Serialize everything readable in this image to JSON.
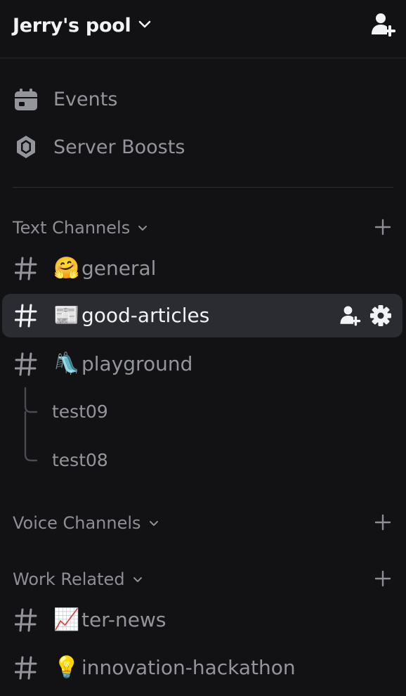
{
  "server": {
    "name": "Jerry's pool"
  },
  "menu": [
    {
      "label": "Events",
      "icon": "calendar-icon"
    },
    {
      "label": "Server Boosts",
      "icon": "boost-gem-icon"
    }
  ],
  "categories": {
    "text": {
      "label": "Text Channels"
    },
    "voice": {
      "label": "Voice Channels"
    },
    "work": {
      "label": "Work Related"
    }
  },
  "channels": {
    "general": {
      "emoji": "🤗",
      "name": "general"
    },
    "good_articles": {
      "emoji": "📰",
      "name": "good-articles"
    },
    "playground": {
      "emoji": "🛝",
      "name": "playground"
    },
    "ter_news": {
      "emoji": "📈",
      "name": "ter-news"
    },
    "innovation_hackathon": {
      "emoji": "💡",
      "name": "innovation-hackathon"
    }
  },
  "threads": [
    {
      "name": "test09"
    },
    {
      "name": "test08"
    }
  ],
  "colors": {
    "background": "#121214",
    "selected_row": "#2b2c31",
    "text_primary": "#f2f3f5",
    "text_muted": "#94959c"
  }
}
